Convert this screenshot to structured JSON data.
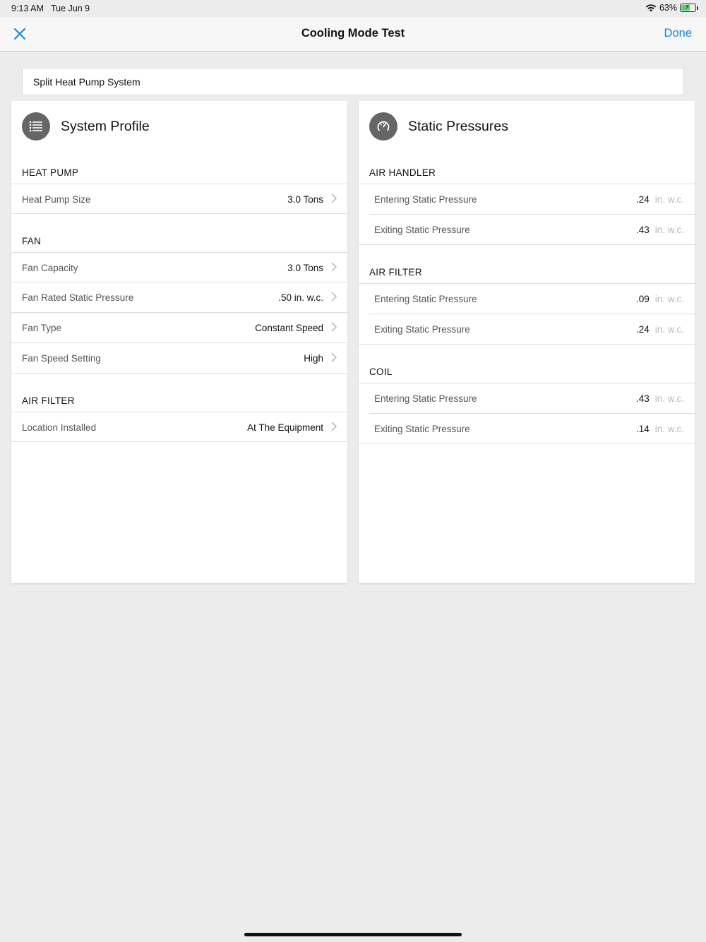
{
  "status_bar": {
    "time": "9:13 AM",
    "date": "Tue Jun 9",
    "battery": "63%",
    "battery_level": 0.63
  },
  "nav": {
    "title": "Cooling Mode Test",
    "done_label": "Done",
    "close_icon": "close-icon"
  },
  "system_type": "Split Heat Pump System",
  "system_profile": {
    "title": "System Profile",
    "icon": "list-icon",
    "sections": {
      "heat_pump": {
        "label": "HEAT PUMP",
        "rows": [
          {
            "label": "Heat Pump Size",
            "value": "3.0 Tons"
          }
        ]
      },
      "fan": {
        "label": "FAN",
        "rows": [
          {
            "label": "Fan Capacity",
            "value": "3.0 Tons"
          },
          {
            "label": "Fan Rated Static Pressure",
            "value": ".50 in. w.c."
          },
          {
            "label": "Fan Type",
            "value": "Constant Speed"
          },
          {
            "label": "Fan Speed Setting",
            "value": "High"
          }
        ]
      },
      "air_filter": {
        "label": "AIR FILTER",
        "rows": [
          {
            "label": "Location Installed",
            "value": "At The Equipment"
          }
        ]
      }
    }
  },
  "static_pressures": {
    "title": "Static Pressures",
    "icon": "gauge-icon",
    "unit": "in. w.c.",
    "sections": {
      "air_handler": {
        "label": "AIR HANDLER",
        "rows": [
          {
            "label": "Entering Static Pressure",
            "value": ".24"
          },
          {
            "label": "Exiting Static Pressure",
            "value": ".43"
          }
        ]
      },
      "air_filter": {
        "label": "AIR FILTER",
        "rows": [
          {
            "label": "Entering Static Pressure",
            "value": ".09"
          },
          {
            "label": "Exiting Static Pressure",
            "value": ".24"
          }
        ]
      },
      "coil": {
        "label": "COIL",
        "rows": [
          {
            "label": "Entering Static Pressure",
            "value": ".43"
          },
          {
            "label": "Exiting Static Pressure",
            "value": ".14"
          }
        ]
      }
    }
  },
  "colors": {
    "accent": "#1a82e2",
    "background": "#ececec",
    "icon_bg": "#666666"
  }
}
